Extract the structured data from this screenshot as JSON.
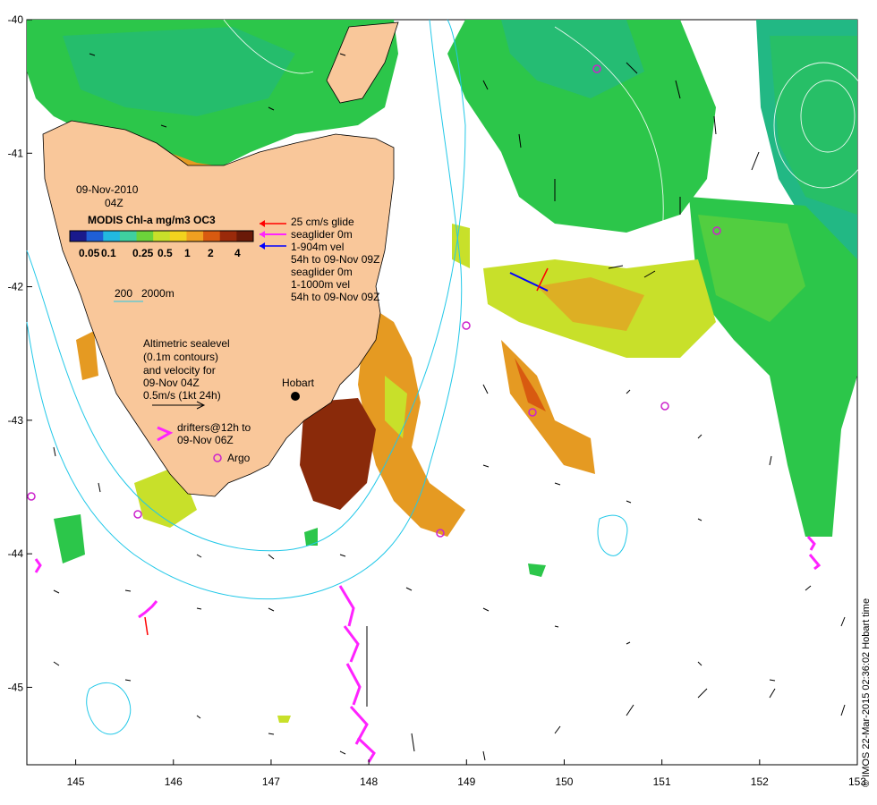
{
  "legend": {
    "date": "09-Nov-2010",
    "time": "04Z",
    "colorbar_title": "MODIS Chl-a mg/m3 OC3",
    "colorbar_ticks": [
      "0.05",
      "0.1",
      "0.25",
      "0.5",
      "1",
      "2",
      "4"
    ],
    "colorbar_colors": [
      "#1a1a8c",
      "#1f5fd6",
      "#22b8e0",
      "#3fd0a0",
      "#6cd33a",
      "#c8e02a",
      "#f2d21e",
      "#f0a020",
      "#d85a10",
      "#9a2a0a",
      "#6a1a08"
    ],
    "glider_line1": "25 cm/s glide",
    "glider_line2": "seaglider 0m",
    "glider_line3": "1-904m vel",
    "glider_line4": "54h to 09-Nov 09Z",
    "glider_line5": "seaglider 0m",
    "glider_line6": "1-1000m vel",
    "glider_line7": "54h to 09-Nov 09Z",
    "depth_200": "200",
    "depth_2000": "2000m",
    "alt_line1": "Altimetric sealevel",
    "alt_line2": "(0.1m contours)",
    "alt_line3": "and velocity for",
    "alt_line4": "09-Nov 04Z",
    "alt_line5": "0.5m/s (1kt 24h)",
    "drifters_line1": "drifters@12h to",
    "drifters_line2": "09-Nov 06Z",
    "argo_label": "Argo",
    "place_hobart": "Hobart"
  },
  "axes": {
    "x_ticks": [
      "145",
      "146",
      "147",
      "148",
      "149",
      "150",
      "151",
      "152",
      "153"
    ],
    "y_ticks": [
      "-40",
      "-41",
      "-42",
      "-43",
      "-44",
      "-45"
    ]
  },
  "colors": {
    "land": "#f9c79a",
    "chl_green": "#2cc64a",
    "chl_teal": "#22b884",
    "chl_yellow": "#c8e02a",
    "chl_orange": "#e59a22",
    "chl_brown": "#8a2a0a",
    "isobath": "#22c8e8",
    "drifter": "#ff22ff",
    "argo": "#cc22cc",
    "arrow_red": "#ff0000",
    "arrow_blue": "#0000ff"
  },
  "credit": "© IMOS 22-Mar-2015 02:36:02 Hobart time"
}
